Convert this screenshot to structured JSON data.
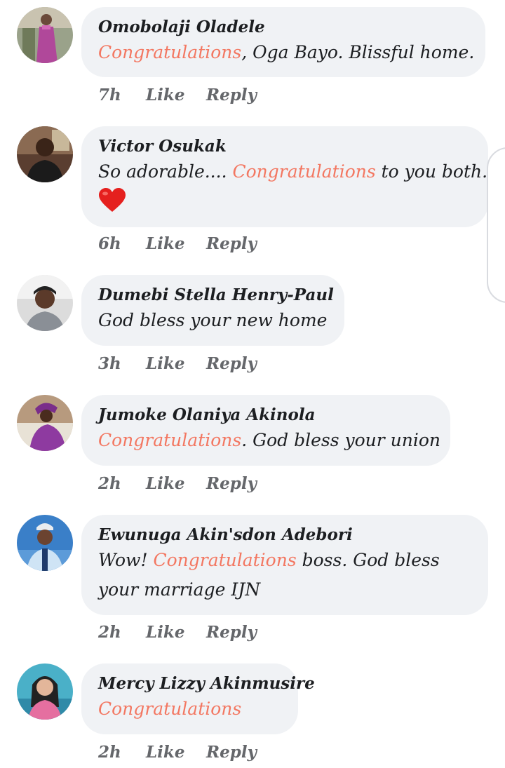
{
  "comments": [
    {
      "author": "Omobolaji Oladele",
      "text": [
        {
          "t": "Congratulations",
          "hl": true
        },
        {
          "t": ", Oga Bayo. Blissful home.",
          "hl": false
        }
      ],
      "time": "7h",
      "like_label": "Like",
      "reply_label": "Reply"
    },
    {
      "author": "Victor Osukak",
      "text": [
        {
          "t": "So adorable.... ",
          "hl": false
        },
        {
          "t": "Congratulations",
          "hl": true
        },
        {
          "t": " to you both.",
          "hl": false
        }
      ],
      "emoji": "red-heart",
      "time": "6h",
      "like_label": "Like",
      "reply_label": "Reply"
    },
    {
      "author": "Dumebi Stella Henry-Paul",
      "text": [
        {
          "t": "God bless your new home",
          "hl": false
        }
      ],
      "time": "3h",
      "like_label": "Like",
      "reply_label": "Reply"
    },
    {
      "author": "Jumoke Olaniya Akinola",
      "text": [
        {
          "t": "Congratulations",
          "hl": true
        },
        {
          "t": ". God bless your union",
          "hl": false
        }
      ],
      "time": "2h",
      "like_label": "Like",
      "reply_label": "Reply"
    },
    {
      "author": "Ewunuga Akin'sdon Adebori",
      "text": [
        {
          "t": "Wow! ",
          "hl": false
        },
        {
          "t": "Congratulations",
          "hl": true
        },
        {
          "t": " boss. God bless",
          "hl": false
        }
      ],
      "text_line2": "your marriage IJN",
      "time": "2h",
      "like_label": "Like",
      "reply_label": "Reply"
    },
    {
      "author": "Mercy Lizzy Akinmusire",
      "text": [
        {
          "t": "Congratulations",
          "hl": true
        }
      ],
      "time": "2h",
      "like_label": "Like",
      "reply_label": "Reply"
    }
  ],
  "colors": {
    "bubble": "#f0f2f5",
    "highlight": "#f37761",
    "meta": "#65676b",
    "text": "#1c1e21"
  }
}
